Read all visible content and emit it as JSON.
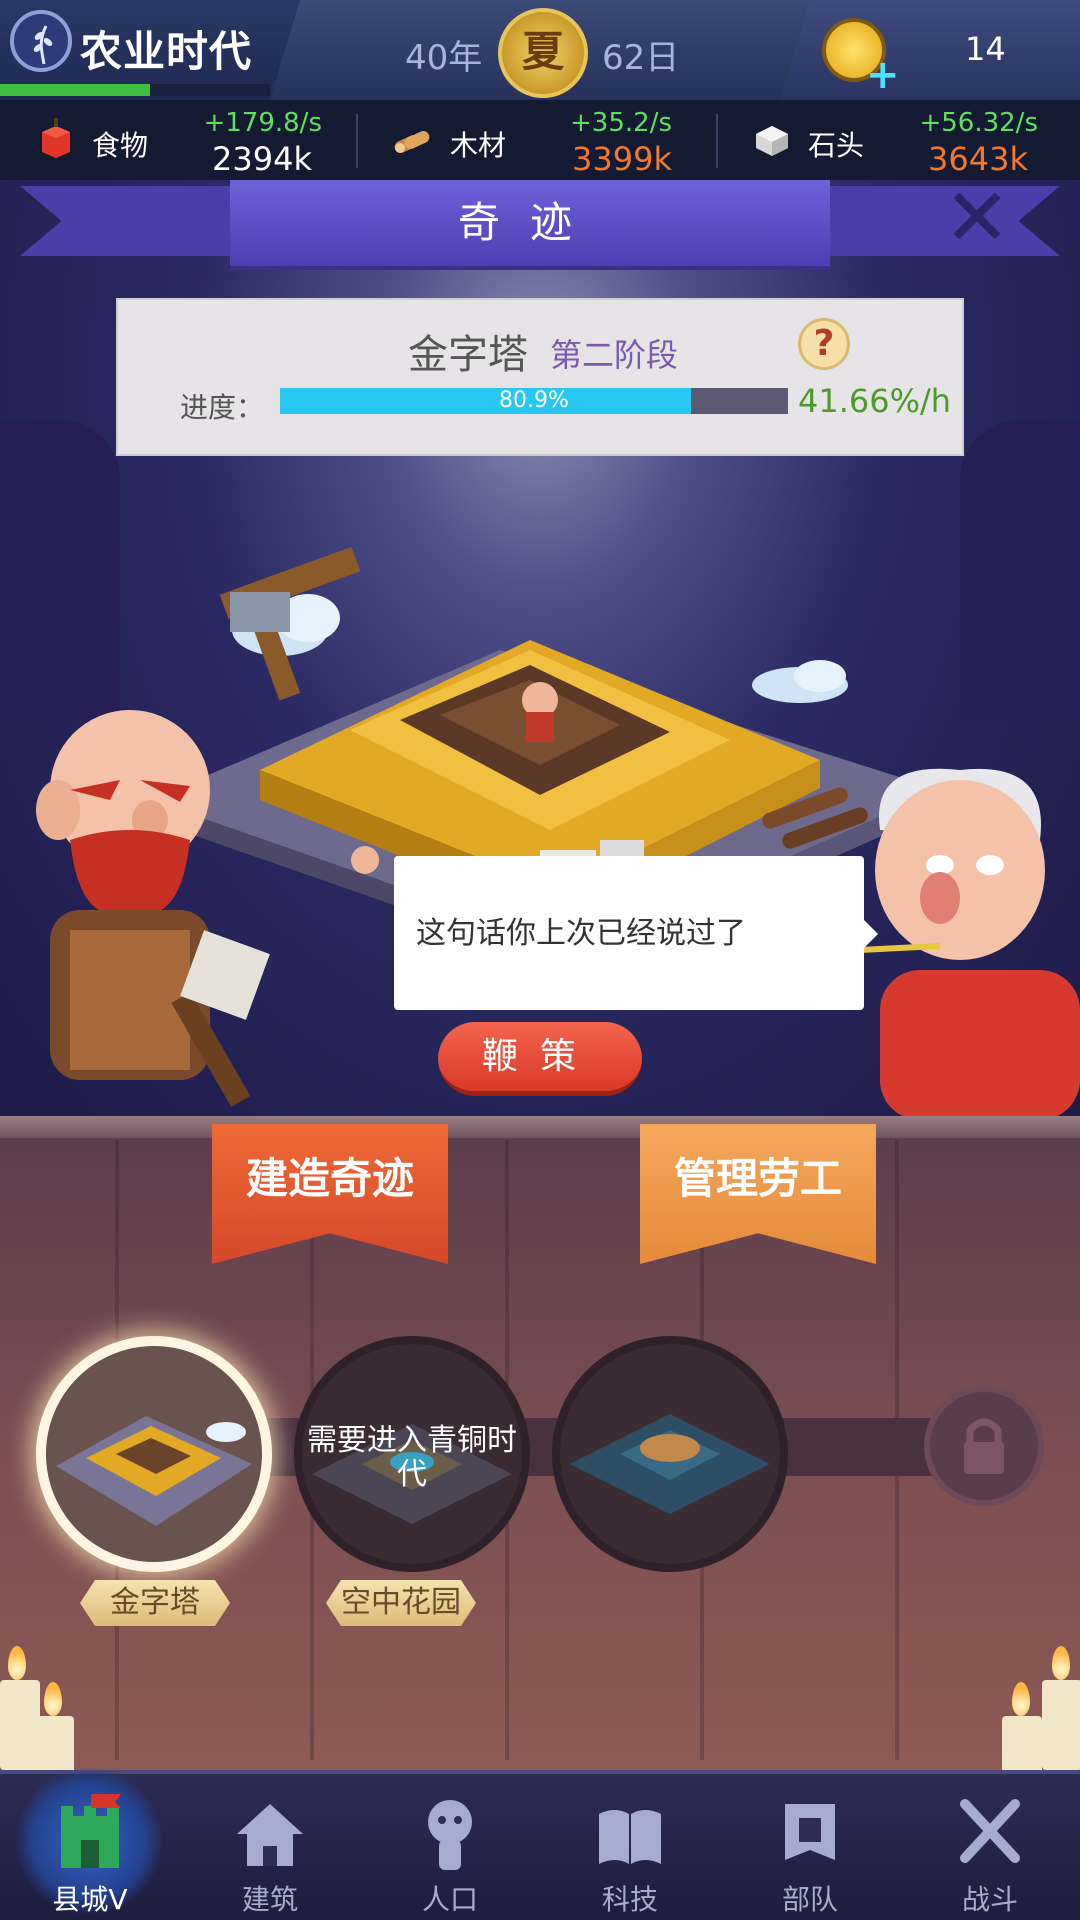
{
  "header": {
    "era_name": "农业时代",
    "year": "40年",
    "season": "夏",
    "day": "62日",
    "coins": "14"
  },
  "resources": [
    {
      "name": "食物",
      "rate": "+179.8/s",
      "amount": "2394k",
      "icon": "apple-icon",
      "amount_color": "#ffffff"
    },
    {
      "name": "木材",
      "rate": "+35.2/s",
      "amount": "3399k",
      "icon": "wood-icon",
      "amount_color": "#f07a2a"
    },
    {
      "name": "石头",
      "rate": "+56.32/s",
      "amount": "3643k",
      "icon": "stone-icon",
      "amount_color": "#f07a2a"
    }
  ],
  "wonder_panel": {
    "title": "奇迹",
    "wonder_name": "金字塔",
    "stage": "第二阶段",
    "progress_label": "进度：",
    "progress_percent": 80.9,
    "progress_text": "80.9%",
    "rate": "41.66%/h"
  },
  "dialog": {
    "text": "这句话你上次已经说过了"
  },
  "whip_button": "鞭策",
  "tabs": {
    "build": "建造奇迹",
    "labor": "管理劳工"
  },
  "wonders": [
    {
      "name": "金字塔",
      "selected": true,
      "locked_text": ""
    },
    {
      "name": "空中花园",
      "selected": false,
      "locked_text": "需要进入青铜时代"
    },
    {
      "name": "",
      "selected": false,
      "locked_text": ""
    }
  ],
  "nav": [
    {
      "label": "县城V",
      "icon": "castle-icon",
      "active": true
    },
    {
      "label": "建筑",
      "icon": "house-icon",
      "active": false
    },
    {
      "label": "人口",
      "icon": "person-icon",
      "active": false
    },
    {
      "label": "科技",
      "icon": "book-icon",
      "active": false
    },
    {
      "label": "部队",
      "icon": "banner-icon",
      "active": false
    },
    {
      "label": "战斗",
      "icon": "crossed-swords-icon",
      "active": false
    }
  ],
  "colors": {
    "progress_fill": "#29c8f2",
    "rate_green": "#5de05d",
    "amount_orange": "#f07a2a",
    "build_tab": "#e45a30",
    "labor_tab": "#f09a4a",
    "whip_button": "#e64a36"
  }
}
